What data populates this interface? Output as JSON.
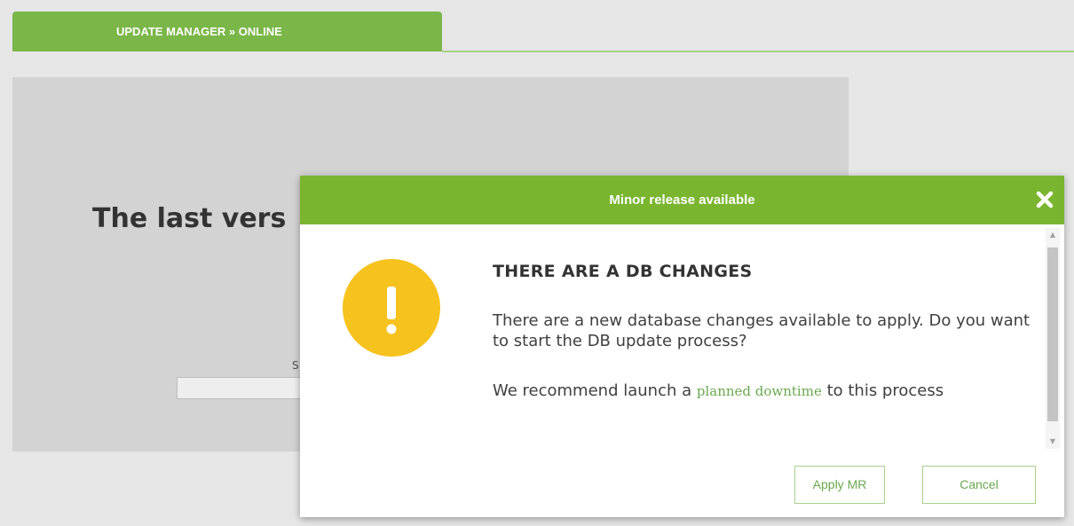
{
  "tab": {
    "label": "UPDATE MANAGER » ONLINE"
  },
  "background": {
    "title": "The last vers",
    "small_label": "S"
  },
  "modal": {
    "title": "Minor release available",
    "heading": "THERE ARE A DB CHANGES",
    "paragraph1": "There are a new database changes available to apply. Do you want to start the DB update process?",
    "paragraph2_before": "We recommend launch a ",
    "paragraph2_link": "planned downtime",
    "paragraph2_after": " to this process",
    "apply_label": "Apply MR",
    "cancel_label": "Cancel",
    "icons": {
      "close": "close-icon",
      "warning": "exclamation-warning-icon",
      "scroll_up": "triangle-up-icon",
      "scroll_down": "triangle-down-icon"
    },
    "colors": {
      "header": "#7ab52f",
      "warning": "#f6c21d",
      "link": "#6aa84f"
    }
  }
}
